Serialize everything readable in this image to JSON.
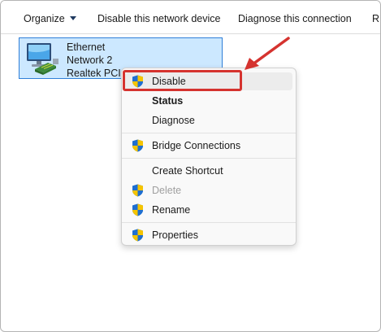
{
  "toolbar": {
    "organize_label": "Organize",
    "disable_label": "Disable this network device",
    "diagnose_label": "Diagnose this connection",
    "overflow_label": "R"
  },
  "adapter": {
    "name": "Ethernet",
    "network": "Network 2",
    "device": "Realtek PCIe"
  },
  "context_menu": {
    "items": [
      {
        "label": "Disable",
        "icon": "shield-icon"
      },
      {
        "label": "Status",
        "style": "bold"
      },
      {
        "label": "Diagnose"
      },
      {
        "label": "Bridge Connections",
        "icon": "shield-icon"
      },
      {
        "label": "Create Shortcut"
      },
      {
        "label": "Delete",
        "icon": "shield-icon",
        "state": "disabled"
      },
      {
        "label": "Rename",
        "icon": "shield-icon"
      },
      {
        "label": "Properties",
        "icon": "shield-icon"
      }
    ]
  },
  "colors": {
    "highlight_red": "#d5332f",
    "selection_blue": "#cce8ff"
  }
}
